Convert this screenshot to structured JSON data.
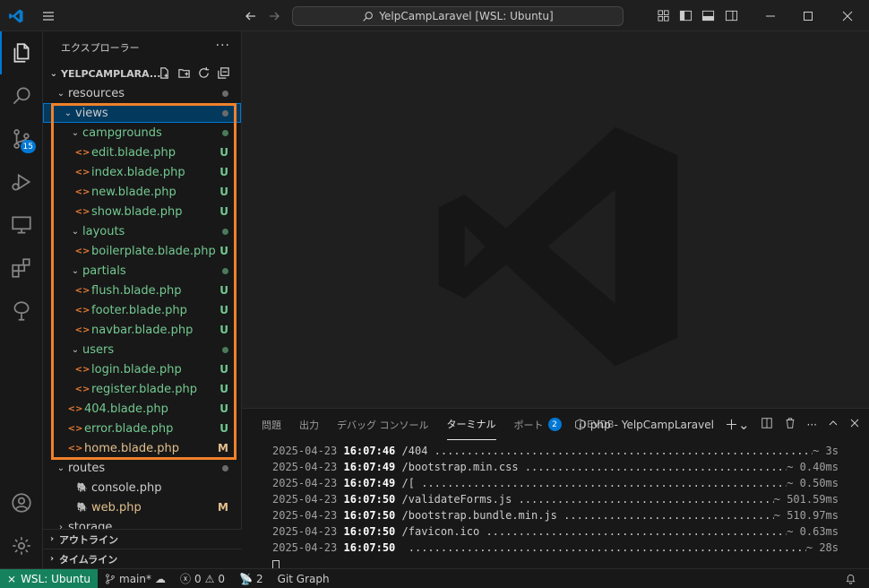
{
  "titlebar": {
    "search_text": "YelpCampLaravel [WSL: Ubuntu]"
  },
  "activity": {
    "scm_badge": "15"
  },
  "sidebar": {
    "title": "エクスプローラー",
    "more": "···",
    "section_title": "YELPCAMPLARA...",
    "tree": [
      {
        "label": "resources",
        "type": "folder",
        "indent": 1,
        "status": "dot",
        "color": "normal"
      },
      {
        "label": "views",
        "type": "folder",
        "indent": 2,
        "status": "dot",
        "color": "normal",
        "selected": true
      },
      {
        "label": "campgrounds",
        "type": "folder",
        "indent": 3,
        "status": "dot",
        "color": "green"
      },
      {
        "label": "edit.blade.php",
        "type": "file",
        "indent": 4,
        "status": "U",
        "color": "green"
      },
      {
        "label": "index.blade.php",
        "type": "file",
        "indent": 4,
        "status": "U",
        "color": "green"
      },
      {
        "label": "new.blade.php",
        "type": "file",
        "indent": 4,
        "status": "U",
        "color": "green"
      },
      {
        "label": "show.blade.php",
        "type": "file",
        "indent": 4,
        "status": "U",
        "color": "green"
      },
      {
        "label": "layouts",
        "type": "folder",
        "indent": 3,
        "status": "dot",
        "color": "green"
      },
      {
        "label": "boilerplate.blade.php",
        "type": "file",
        "indent": 4,
        "status": "U",
        "color": "green"
      },
      {
        "label": "partials",
        "type": "folder",
        "indent": 3,
        "status": "dot",
        "color": "green"
      },
      {
        "label": "flush.blade.php",
        "type": "file",
        "indent": 4,
        "status": "U",
        "color": "green"
      },
      {
        "label": "footer.blade.php",
        "type": "file",
        "indent": 4,
        "status": "U",
        "color": "green"
      },
      {
        "label": "navbar.blade.php",
        "type": "file",
        "indent": 4,
        "status": "U",
        "color": "green"
      },
      {
        "label": "users",
        "type": "folder",
        "indent": 3,
        "status": "dot",
        "color": "green"
      },
      {
        "label": "login.blade.php",
        "type": "file",
        "indent": 4,
        "status": "U",
        "color": "green"
      },
      {
        "label": "register.blade.php",
        "type": "file",
        "indent": 4,
        "status": "U",
        "color": "green"
      },
      {
        "label": "404.blade.php",
        "type": "file",
        "indent": 3,
        "status": "U",
        "color": "green"
      },
      {
        "label": "error.blade.php",
        "type": "file",
        "indent": 3,
        "status": "U",
        "color": "green"
      },
      {
        "label": "home.blade.php",
        "type": "file",
        "indent": 3,
        "status": "M",
        "color": "modified"
      },
      {
        "label": "routes",
        "type": "folder",
        "indent": 1,
        "status": "dot",
        "color": "normal"
      },
      {
        "label": "console.php",
        "type": "php",
        "indent": 2,
        "status": "",
        "color": "normal"
      },
      {
        "label": "web.php",
        "type": "php",
        "indent": 2,
        "status": "M",
        "color": "modified"
      },
      {
        "label": "storage",
        "type": "folder-closed",
        "indent": 1,
        "status": "",
        "color": "normal"
      }
    ],
    "outline_label": "アウトライン",
    "timeline_label": "タイムライン"
  },
  "panel": {
    "tabs": [
      {
        "label": "問題"
      },
      {
        "label": "出力"
      },
      {
        "label": "デバッグ コンソール"
      },
      {
        "label": "ターミナル",
        "active": true
      },
      {
        "label": "ポート",
        "badge": "2"
      },
      {
        "label": "DEVDB"
      }
    ],
    "terminal_name": "php - YelpCampLaravel",
    "lines": [
      {
        "date": "2025-04-23",
        "time": "16:07:46",
        "path": "/404",
        "dur": "~ 3s"
      },
      {
        "date": "2025-04-23",
        "time": "16:07:49",
        "path": "/bootstrap.min.css",
        "dur": "~ 0.40ms"
      },
      {
        "date": "2025-04-23",
        "time": "16:07:49",
        "path": "/[",
        "dur": "~ 0.50ms"
      },
      {
        "date": "2025-04-23",
        "time": "16:07:50",
        "path": "/validateForms.js",
        "dur": "~ 501.59ms"
      },
      {
        "date": "2025-04-23",
        "time": "16:07:50",
        "path": "/bootstrap.bundle.min.js",
        "dur": "~ 510.97ms"
      },
      {
        "date": "2025-04-23",
        "time": "16:07:50",
        "path": "/favicon.ico",
        "dur": "~ 0.63ms"
      },
      {
        "date": "2025-04-23",
        "time": "16:07:50",
        "path": "",
        "dur": "~ 28s"
      }
    ]
  },
  "statusbar": {
    "remote": "WSL: Ubuntu",
    "branch": "main*",
    "errors": "0",
    "warnings": "0",
    "ports": "2",
    "git_graph": "Git Graph"
  },
  "colors": {
    "accent": "#0078d4",
    "remote_bg": "#16825d",
    "untracked": "#73c991",
    "modified": "#e2c08d",
    "highlight": "#f0812a"
  }
}
